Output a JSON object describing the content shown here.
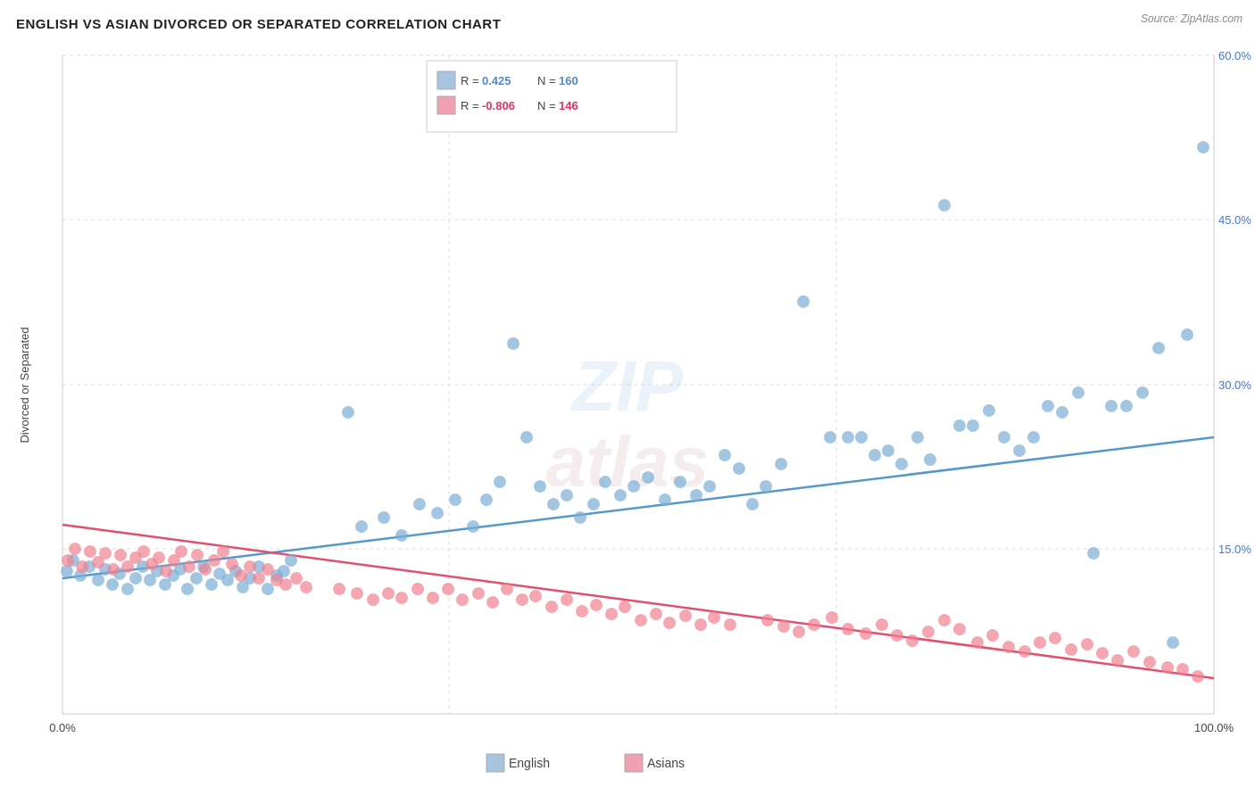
{
  "title": "ENGLISH VS ASIAN DIVORCED OR SEPARATED CORRELATION CHART",
  "source": "Source: ZipAtlas.com",
  "yAxisLabel": "Divorced or Separated",
  "xAxisLabels": [
    "0.0%",
    "100.0%"
  ],
  "yAxisLabels": [
    "15.0%",
    "30.0%",
    "45.0%",
    "60.0%"
  ],
  "legend": {
    "english": {
      "color": "#a8c4e0",
      "r_label": "R =",
      "r_value": "0.425",
      "n_label": "N =",
      "n_value": "160"
    },
    "asians": {
      "color": "#f0a0b0",
      "r_label": "R =",
      "r_value": "-0.806",
      "n_label": "N =",
      "n_value": "146"
    }
  },
  "bottomLegend": {
    "english": {
      "label": "English",
      "color": "#a8c4e0"
    },
    "asians": {
      "label": "Asians",
      "color": "#f0a0b0"
    }
  },
  "watermark": {
    "zip": "ZIP",
    "atlas": "atlas"
  },
  "colors": {
    "english_dot": "#7aaed4",
    "asians_dot": "#f08090",
    "english_line": "#5599cc",
    "asians_line": "#e05070",
    "grid": "#ddd"
  }
}
